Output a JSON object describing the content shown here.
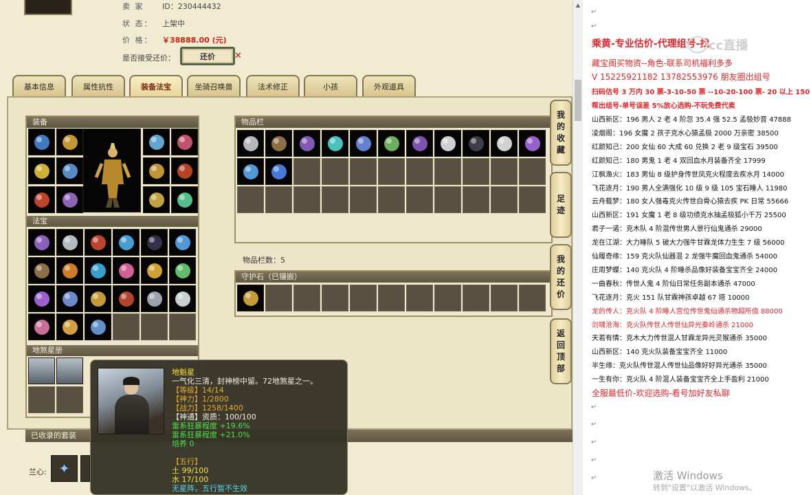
{
  "listing": {
    "seller_label": "卖 家",
    "seller_id": "ID：230444432",
    "status_label": "状 态：",
    "status_value": "上架中",
    "price_label": "价 格：",
    "price_value": "￥38888.00 (元)",
    "haggle_label": "是否接受还价：",
    "haggle_button": "还价",
    "haggle_mark": "✕"
  },
  "tabs": [
    "基本信息",
    "属性抗性",
    "装备法宝",
    "坐骑召唤兽",
    "法术修正",
    "小孩",
    "外观道具"
  ],
  "active_tab": "装备法宝",
  "sections": {
    "equip": "装备",
    "fabao": "法宝",
    "disha": "地煞星册",
    "bag": "物品栏",
    "bag_count": "物品栏数：5",
    "guard": "守护石（已镶嵌）",
    "suits": "已收录的套装",
    "suit_row_label": "兰心:"
  },
  "side_buttons": [
    {
      "label": [
        "我",
        "的",
        "收",
        "藏"
      ]
    },
    {
      "label": [
        "足",
        "迹"
      ]
    },
    {
      "label": [
        "我",
        "的",
        "还",
        "价"
      ]
    },
    {
      "label": [
        "返",
        "回",
        "顶",
        "部"
      ]
    }
  ],
  "tooltip": {
    "name": "地魁星",
    "desc": "一气化三清，封神榜中留。72地煞星之一。",
    "level": "【等级】14/14",
    "shenli": "【神力】1/2800",
    "zhanli": "【战力】1258/1400",
    "shentong": "【神通】资质：100/100",
    "bonus1": "雷系狂暴程度 +19.6%",
    "bonus2": "雷系狂暴程度 +21.0%",
    "peiyang": "培养 0",
    "wuxing": "【五行】",
    "tu": "土 99/100",
    "shui": "水 17/100",
    "note": "无星阵，五行暂不生效"
  },
  "right_pane": {
    "logo_text": "cc直播",
    "headline": "乘黄-专业估价-代理组号-找",
    "line2": "藏宝阁买物资--角色-联系司机福利多多",
    "line3": "V 15225921182   13782553976 朋友圈出组号",
    "line4": "扫码估号 3 万内 30 票-3-10-50 票 --10-20-100 票- 20 以上 150",
    "line5": "帮出组号-单号误差 5%放心选购-不玩免费代卖",
    "entries": [
      {
        "text": "山西新区：196 男人 2 老 4 阶忽 35.4 强 52.5 孟极妙音 47888",
        "red": false
      },
      {
        "text": "凌烟阁：196 女魔 2 孩子克水心猿孟极 2000 万亲密 38500",
        "red": false
      },
      {
        "text": "红颜知己：200 女仙 60 大成 60 兑换 2 老 9 级宝石 39500",
        "red": false
      },
      {
        "text": "红颜知己：180 男鬼 1 老 4 双回血水月装备齐全 17999",
        "red": false
      },
      {
        "text": "江枫渔火：183 男仙 8 级护身传世凤克火程度去疾水月 14000",
        "red": false
      },
      {
        "text": "飞花逐月：190 男人全满强化 10 级 9 级 105 宝石睡人 11980",
        "red": false
      },
      {
        "text": "云舟载梦：180 女人强毒克火传世白骨心猿去疾 PK 日常 55666",
        "red": false
      },
      {
        "text": "山西新区：191 女魔 1 老 8 级功绩克水抽孟极狐小千万 25500",
        "red": false
      },
      {
        "text": "君子一诺：克木队 4 阶混传世男人景行仙鬼通杀 29000",
        "red": false
      },
      {
        "text": "龙在江湖：大力睡队 5 破大力强牛甘霖龙体力生生 7 级 56000",
        "red": false
      },
      {
        "text": "仙履奇缘：159 克火队仙器混 2 龙强牛魔回血鬼通杀 54000",
        "red": false
      },
      {
        "text": "庄周梦蝶：140 克火队 4 阶睡杀品像好装备宝宝齐全 24000",
        "red": false
      },
      {
        "text": "一曲春秋：传世人鬼 4 阶仙日常任务副本通杀 47000",
        "red": false
      },
      {
        "text": "飞花逐月：克火 151 队甘霖神孩卓越 67 塔 10000",
        "red": false
      },
      {
        "text": "龙的传人：克火队 4 阶睡人宫位传世鬼仙通杀物超所值 88000",
        "red": true
      },
      {
        "text": "剑啸沧海：克火队传世人传世仙异光秦岭通杀 21000",
        "red": true
      },
      {
        "text": "天若有情：克木大力传世混人甘霖龙异光灵猴通杀 35000",
        "red": false
      },
      {
        "text": "山西新区：140 克火队装备宝宝齐全 11000",
        "red": false
      },
      {
        "text": "半生缘：克火队传世混人传世仙品像好好异光通杀 35000",
        "red": false
      },
      {
        "text": "一生有你：克火队 4 阶混人装备宝宝齐全上手盈利 21000",
        "red": false
      }
    ],
    "footer": "全服最低价-欢迎选购-看号加好友私聊",
    "para_mark": "↵",
    "win1": "激活 Windows",
    "win2": "转到\"设置\"以激活 Windows。"
  },
  "colors": {
    "accent_red": "#e0262a",
    "price_red": "#cc1f10",
    "panel_bg": "#f1ebd2"
  },
  "icons": {
    "equip": [
      "blue-helmet",
      "gold-necklace",
      "blue-armor-piece",
      "pink-necklace",
      "yellow-orb",
      "blue-gauntlet",
      "gold-ring",
      "red-belt",
      "red-feather",
      "purple-boots",
      "gold-bowl",
      "green-orb"
    ],
    "fabao": [
      "purple-flask",
      "silver-scroll",
      "red-bell",
      "blue-crystal",
      "dark-orb",
      "blue-sword",
      "brown-stone",
      "orange-leaf",
      "blue-fish",
      "pink-lantern",
      "gold-bell",
      "green-gem",
      "purple-string",
      "blue-fan",
      "gold-tower",
      "red-fan",
      "silver-claw",
      "white-umbrella",
      "pink-beads",
      "gold-pearl",
      "blue-shell"
    ],
    "bag": [
      "silver-ring",
      "brown-charm",
      "purple-cone",
      "cyan-staff",
      "blue-ring",
      "green-boots",
      "purple-cloak",
      "white-dagger",
      "dark-ring",
      "white-bow",
      "purple-ring",
      "blue-sword",
      "blue-gem"
    ]
  }
}
